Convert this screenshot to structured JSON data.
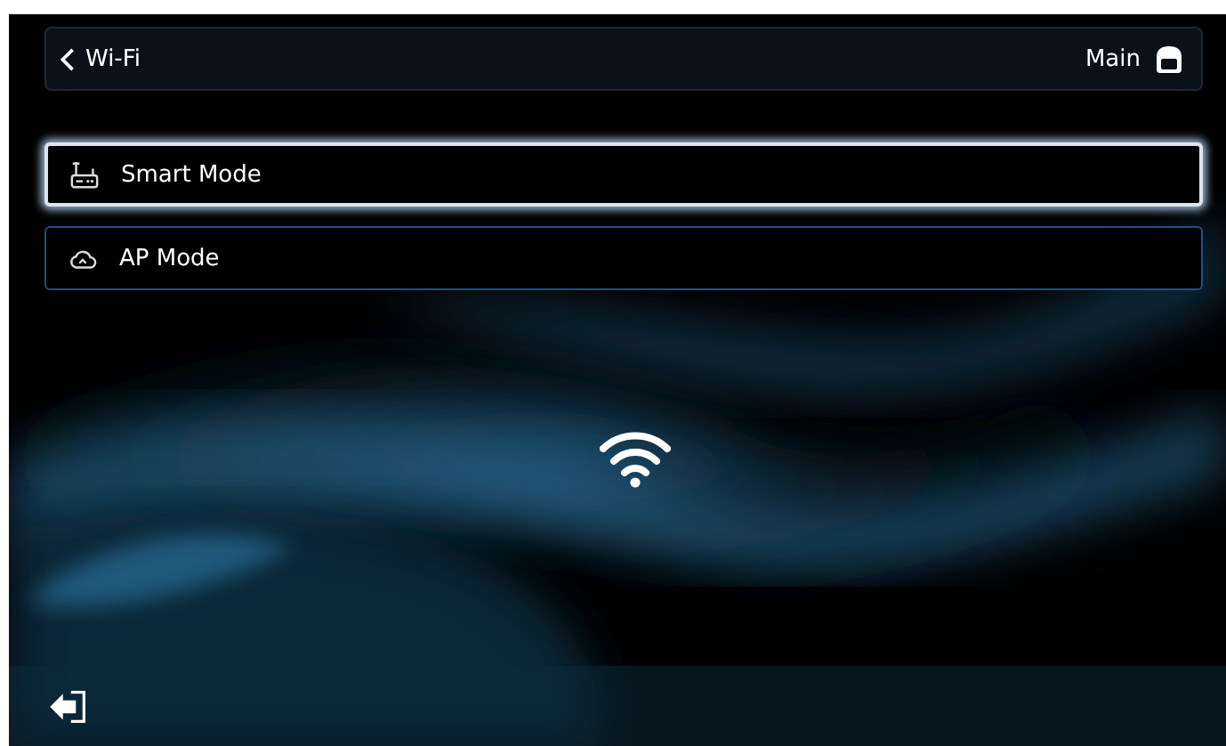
{
  "header": {
    "back_label": "Wi-Fi",
    "home_label": "Main"
  },
  "modes": [
    {
      "label": "Smart Mode",
      "kind": "router",
      "selected": true
    },
    {
      "label": "AP Mode",
      "kind": "cloud",
      "selected": false
    }
  ]
}
